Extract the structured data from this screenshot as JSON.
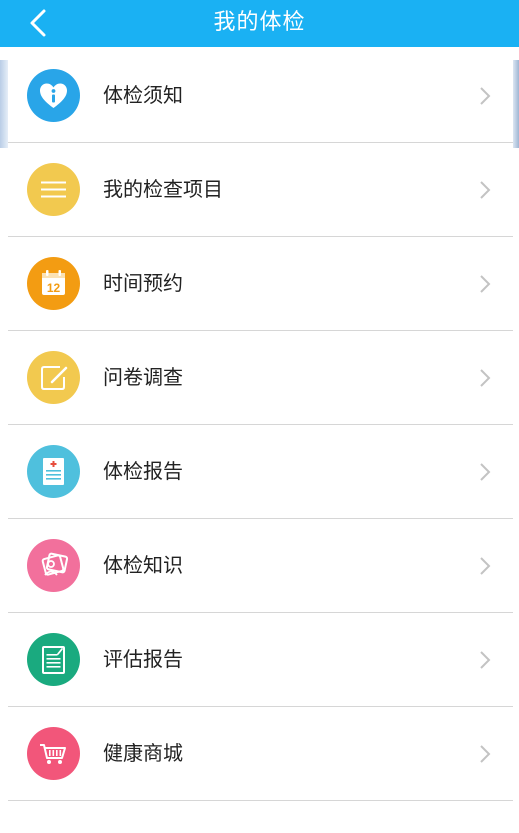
{
  "header": {
    "title": "我的体检",
    "back_icon": "chevron-left-icon",
    "background": "#1ab1f3"
  },
  "menu": {
    "items": [
      {
        "label": "体检须知",
        "icon": "heart-info-icon",
        "color": "#29a5e8"
      },
      {
        "label": "我的检查项目",
        "icon": "list-icon",
        "color": "#f2c94f"
      },
      {
        "label": "时间预约",
        "icon": "calendar-icon",
        "color": "#f39c12",
        "icon_text": "12"
      },
      {
        "label": "问卷调查",
        "icon": "edit-icon",
        "color": "#f2c94f"
      },
      {
        "label": "体检报告",
        "icon": "medical-report-icon",
        "color": "#4fc0dd"
      },
      {
        "label": "体检知识",
        "icon": "knowledge-icon",
        "color": "#f2709c"
      },
      {
        "label": "评估报告",
        "icon": "assessment-report-icon",
        "color": "#1aaa7f"
      },
      {
        "label": "健康商城",
        "icon": "cart-icon",
        "color": "#f2567a"
      }
    ],
    "chevron_icon": "chevron-right-icon"
  }
}
